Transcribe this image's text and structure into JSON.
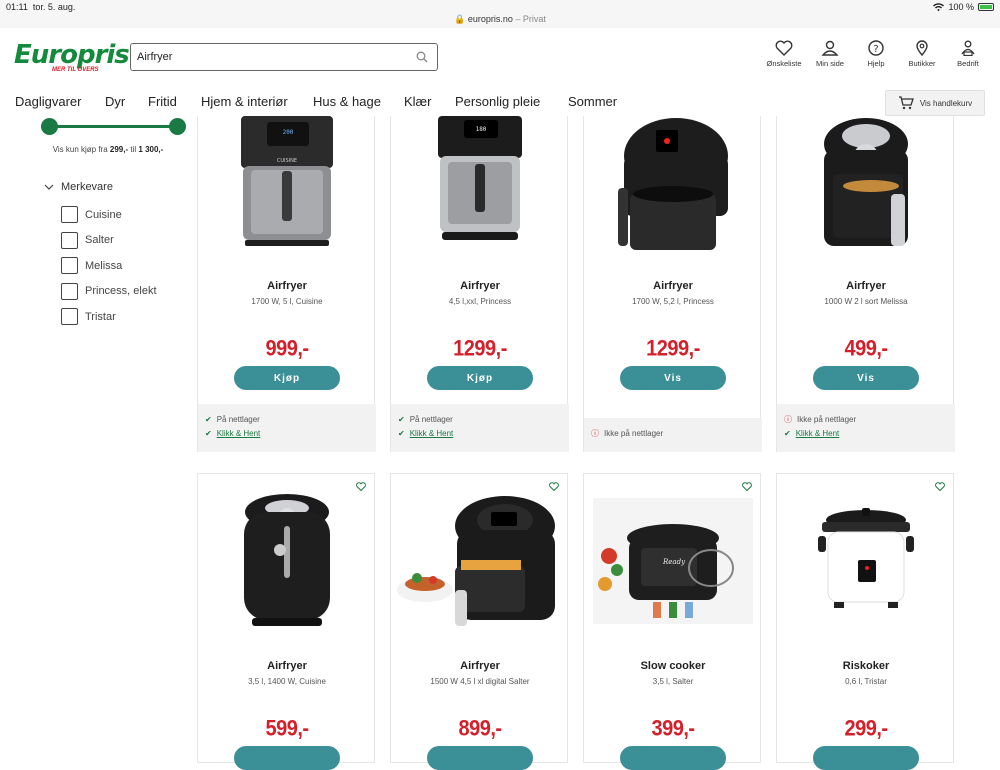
{
  "status": {
    "time": "01:11",
    "date": "tor. 5. aug.",
    "url": "europris.no",
    "privacy": "Privat",
    "battery": "100 %"
  },
  "header": {
    "logo_text": "Europris",
    "logo_tagline": "MER TIL OVERS",
    "search_value": "Airfryer",
    "icons": [
      {
        "label": "Ønskeliste",
        "icon": "heart-icon"
      },
      {
        "label": "Min side",
        "icon": "user-icon"
      },
      {
        "label": "Hjelp",
        "icon": "help-icon"
      },
      {
        "label": "Butikker",
        "icon": "location-icon"
      },
      {
        "label": "Bedrift",
        "icon": "business-icon"
      }
    ]
  },
  "nav": {
    "items": [
      "Dagligvarer",
      "Dyr",
      "Fritid",
      "Hjem & interiør",
      "Hus & hage",
      "Klær",
      "Personlig pleie",
      "Sommer"
    ],
    "cart_label": "Vis handlekurv"
  },
  "filter": {
    "range_prefix": "Vis kun kjøp fra",
    "range_min": "299,-",
    "range_to": "til",
    "range_max": "1 300,-",
    "brand_heading": "Merkevare",
    "brands": [
      "Cuisine",
      "Salter",
      "Melissa",
      "Princess, elekt",
      "Tristar"
    ]
  },
  "products": [
    {
      "title": "Airfryer",
      "sub": "1700 W, 5 l, Cuisine",
      "price": "999,-",
      "button": "Kjøp",
      "stock": [
        {
          "ok": true,
          "text": "På nettlager"
        },
        {
          "ok": true,
          "text": "Klikk & Hent",
          "link": true
        }
      ]
    },
    {
      "title": "Airfryer",
      "sub": "4,5 l,xxl, Princess",
      "price": "1299,-",
      "button": "Kjøp",
      "stock": [
        {
          "ok": true,
          "text": "På nettlager"
        },
        {
          "ok": true,
          "text": "Klikk & Hent",
          "link": true
        }
      ]
    },
    {
      "title": "Airfryer",
      "sub": "1700 W, 5,2 l, Princess",
      "price": "1299,-",
      "button": "Vis",
      "stock": [
        {
          "ok": false,
          "text": "Ikke på nettlager"
        }
      ]
    },
    {
      "title": "Airfryer",
      "sub": "1000 W 2 l sort Melissa",
      "price": "499,-",
      "button": "Vis",
      "stock": [
        {
          "ok": false,
          "text": "Ikke på nettlager"
        },
        {
          "ok": true,
          "text": "Klikk & Hent",
          "link": true
        }
      ]
    },
    {
      "title": "Airfryer",
      "sub": "3,5 l, 1400 W, Cuisine",
      "price": "599,-"
    },
    {
      "title": "Airfryer",
      "sub": "1500 W 4,5 l xl digital Salter",
      "price": "899,-"
    },
    {
      "title": "Slow cooker",
      "sub": "3,5 l, Salter",
      "price": "399,-"
    },
    {
      "title": "Riskoker",
      "sub": "0,6 l, Tristar",
      "price": "299,-"
    }
  ],
  "colors": {
    "brand_green": "#148a3c",
    "price_red": "#d4202a",
    "button_teal": "#3b8f97"
  }
}
